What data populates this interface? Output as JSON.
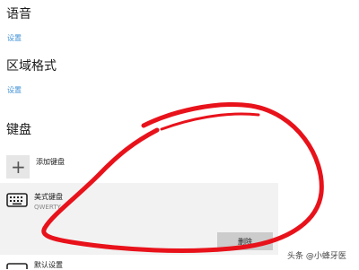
{
  "language": {
    "title": "语音",
    "link": "设置"
  },
  "region": {
    "title": "区域格式",
    "link": "设置"
  },
  "keyboard": {
    "title": "键盘",
    "add_label": "添加键盘",
    "add_icon": "plus-icon",
    "item": {
      "name": "美式键盘",
      "layout": "QWERTY",
      "icon": "keyboard-icon",
      "delete_label": "删除"
    },
    "next_item_partial": "默认设置"
  },
  "watermark": "头条 @小蜂牙医",
  "colors": {
    "link": "#3d8fd6",
    "annotation": "#e8121b"
  }
}
